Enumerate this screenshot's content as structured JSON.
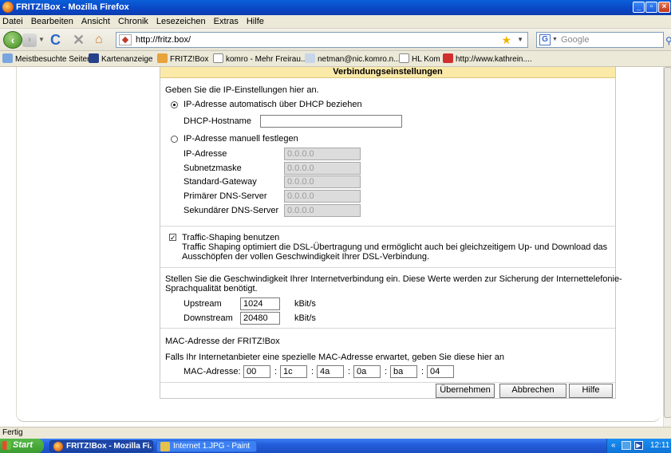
{
  "window": {
    "title": "FRITZ!Box - Mozilla Firefox"
  },
  "menu": {
    "items": [
      "Datei",
      "Bearbeiten",
      "Ansicht",
      "Chronik",
      "Lesezeichen",
      "Extras",
      "Hilfe"
    ]
  },
  "nav": {
    "url": "http://fritz.box/",
    "search_placeholder": "Google"
  },
  "bookmarks": [
    {
      "label": "Meistbesuchte Seiten",
      "icon": "document-icon"
    },
    {
      "label": "Kartenanzeige",
      "icon": "map-icon"
    },
    {
      "label": "FRITZ!Box",
      "icon": "fritzbox-icon"
    },
    {
      "label": "komro - Mehr Freirau...",
      "icon": "page-icon"
    },
    {
      "label": "netman@nic.komro.n...",
      "icon": "web-icon"
    },
    {
      "label": "HL Kom",
      "icon": "page-icon"
    },
    {
      "label": "http://www.kathrein....",
      "icon": "kathrein-icon"
    }
  ],
  "panel": {
    "header": "Verbindungseinstellungen",
    "ip": {
      "intro": "Geben Sie die IP-Einstellungen hier an.",
      "auto_label": "IP-Adresse automatisch über DHCP beziehen",
      "hostname_label": "DHCP-Hostname",
      "hostname_value": "",
      "manual_label": "IP-Adresse manuell festlegen",
      "fields": [
        {
          "label": "IP-Adresse",
          "value": "0.0.0.0"
        },
        {
          "label": "Subnetzmaske",
          "value": "0.0.0.0"
        },
        {
          "label": "Standard-Gateway",
          "value": "0.0.0.0"
        },
        {
          "label": "Primärer DNS-Server",
          "value": "0.0.0.0"
        },
        {
          "label": "Sekundärer DNS-Server",
          "value": "0.0.0.0"
        }
      ]
    },
    "traffic": {
      "checkbox_label": "Traffic-Shaping benutzen",
      "desc1": "Traffic Shaping optimiert die DSL-Übertragung und ermöglicht auch bei gleichzeitigem Up- und Download das",
      "desc2": "Ausschöpfen der vollen Geschwindigkeit Ihrer DSL-Verbindung."
    },
    "speed": {
      "desc1": "Stellen Sie die Geschwindigkeit Ihrer Internetverbindung ein. Diese Werte werden zur Sicherung der Internettelefonie-",
      "desc2": "Sprachqualität benötigt.",
      "upstream_label": "Upstream",
      "upstream_value": "1024",
      "downstream_label": "Downstream",
      "downstream_value": "20480",
      "unit": "kBit/s"
    },
    "mac": {
      "title": "MAC-Adresse der FRITZ!Box",
      "desc": "Falls Ihr Internetanbieter eine spezielle MAC-Adresse erwartet, geben Sie diese hier an",
      "label": "MAC-Adresse:",
      "parts": [
        "00",
        "1c",
        "4a",
        "0a",
        "ba",
        "04"
      ],
      "separator": ":"
    },
    "buttons": {
      "apply": "Übernehmen",
      "cancel": "Abbrechen",
      "help": "Hilfe"
    }
  },
  "status": {
    "text": "Fertig"
  },
  "taskbar": {
    "start": "Start",
    "tasks": [
      "FRITZ!Box - Mozilla Fi...",
      "Internet 1.JPG - Paint"
    ],
    "clock": "12:11"
  }
}
